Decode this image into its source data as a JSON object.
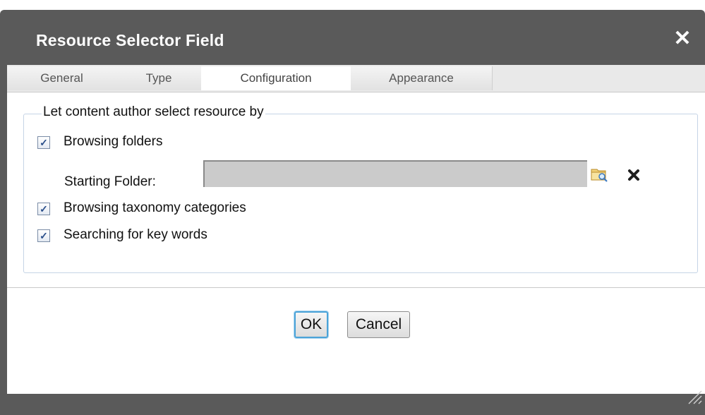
{
  "dialog": {
    "title": "Resource Selector Field",
    "close_icon": "close-icon"
  },
  "tabs": [
    {
      "label": "General",
      "active": false
    },
    {
      "label": "Type",
      "active": false
    },
    {
      "label": "Configuration",
      "active": true
    },
    {
      "label": "Appearance",
      "active": false
    }
  ],
  "group": {
    "legend": "Let content author select resource by",
    "options": [
      {
        "label": "Browsing folders",
        "checked": true
      },
      {
        "label": "Browsing taxonomy categories",
        "checked": true
      },
      {
        "label": "Searching for key words",
        "checked": true
      }
    ],
    "starting_folder": {
      "label": "Starting Folder:",
      "value": "",
      "browse_icon": "folder-search-icon",
      "clear_icon": "clear-x-icon"
    }
  },
  "buttons": {
    "ok": "OK",
    "cancel": "Cancel"
  },
  "colors": {
    "titlebar": "#5a5a5a",
    "checkmark": "#2b4f8a",
    "ok_focus": "#4ba3d8"
  }
}
